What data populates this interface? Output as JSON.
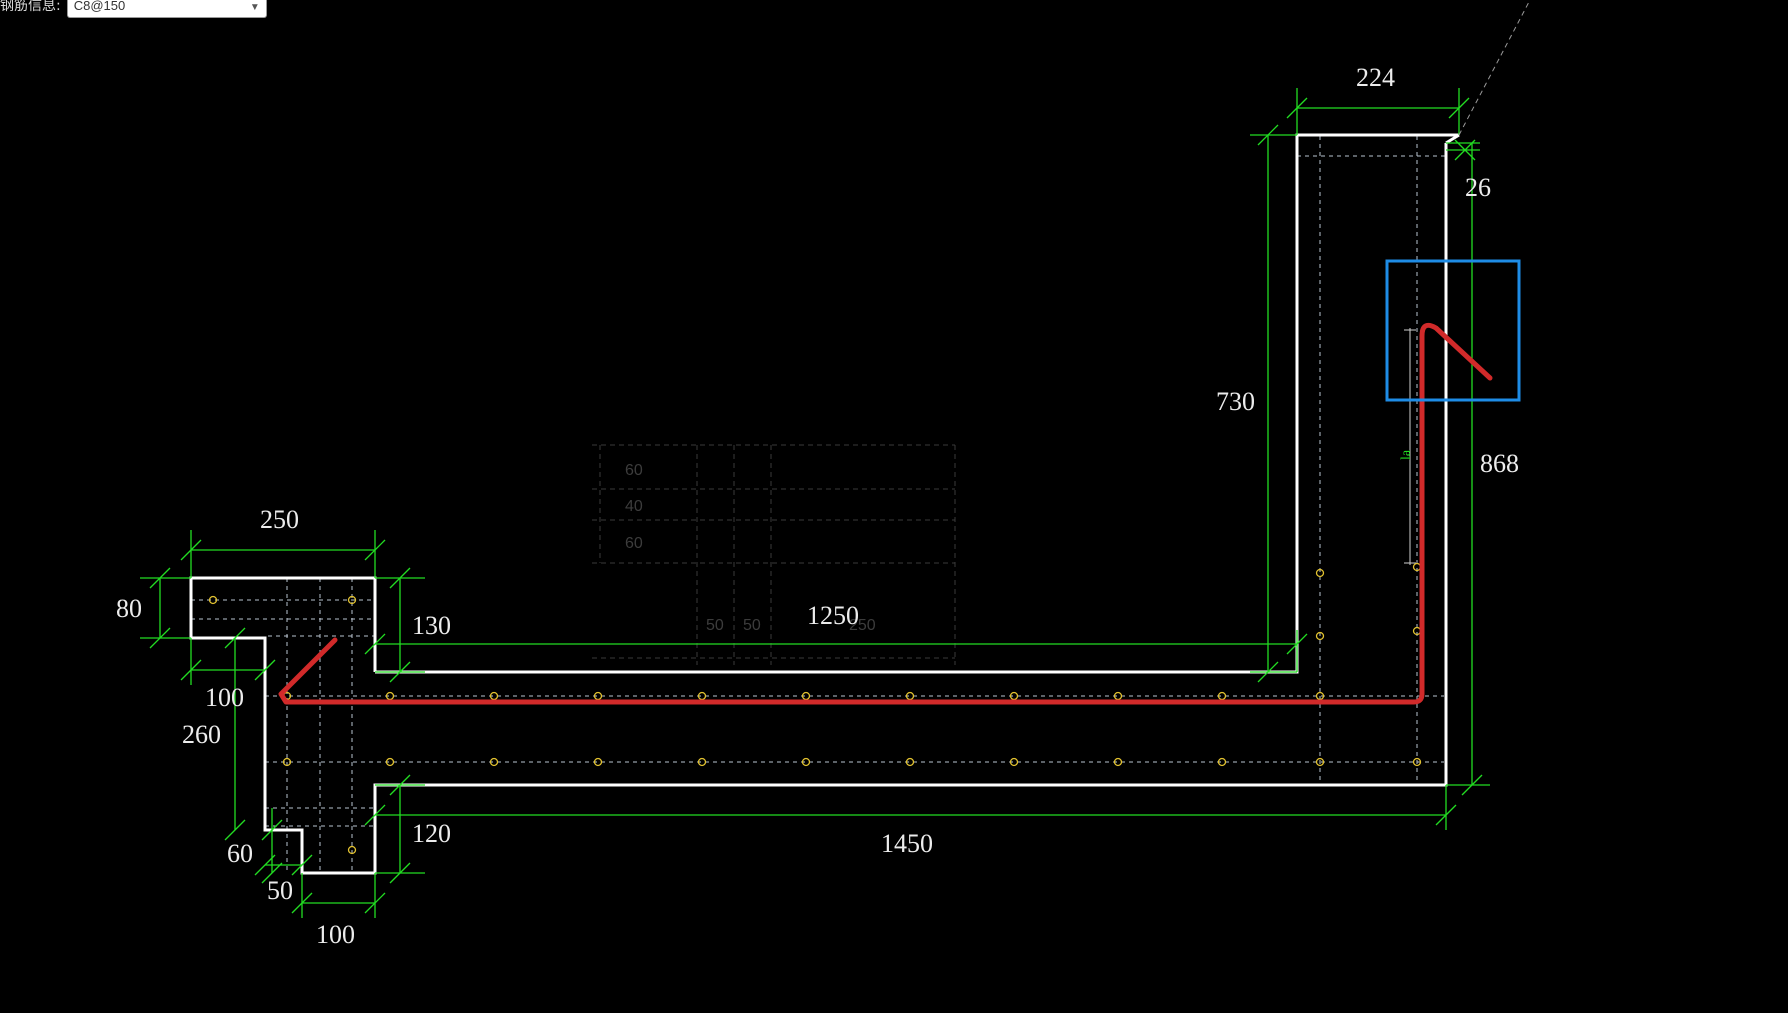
{
  "toolbar": {
    "field_label": "钢筋信息:",
    "field_value": "C8@150"
  },
  "colors": {
    "background": "#000000",
    "outline": "#ffffff",
    "dimension": "#22dd22",
    "hidden_line": "#b9c3cf",
    "rebar": "#d12a2a",
    "highlight_box": "#1e8ce6",
    "rebar_point": "#e2c230"
  },
  "dimensions": {
    "d250": "250",
    "d80": "80",
    "d130": "130",
    "d100_left": "100",
    "d260": "260",
    "d60": "60",
    "d50": "50",
    "d100_bottom": "100",
    "d120": "120",
    "d1250": "1250",
    "d1450": "1450",
    "d224": "224",
    "d26": "26",
    "d730": "730",
    "d868": "868",
    "la": "la"
  },
  "ghost_table": {
    "rows": [
      "60",
      "40",
      "60"
    ],
    "cols": [
      "50",
      "50",
      "250"
    ]
  }
}
